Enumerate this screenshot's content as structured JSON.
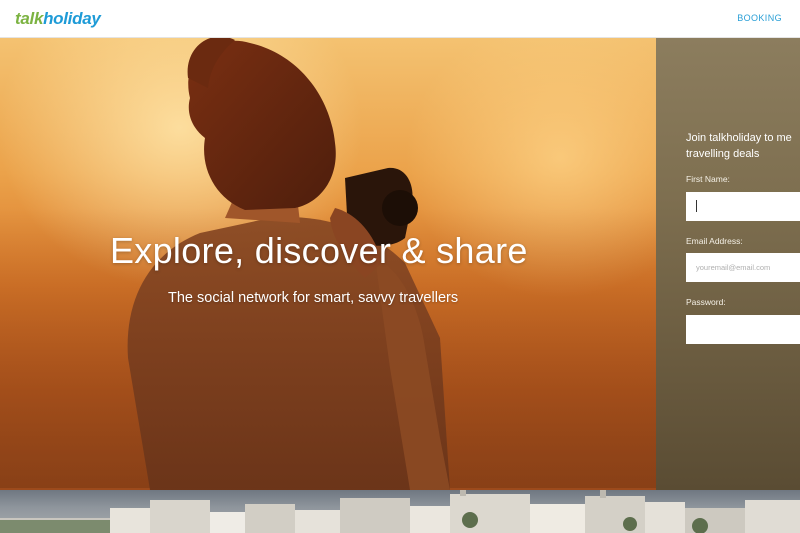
{
  "header": {
    "logo_part1": "talk",
    "logo_part2": "holiday",
    "nav_booking": "BOOKING"
  },
  "hero": {
    "title": "Explore, discover & share",
    "subtitle": "The social network for smart, savvy travellers"
  },
  "signup": {
    "heading_line1": "Join talkholiday to me",
    "heading_line2": "travelling deals",
    "first_name_label": "First Name:",
    "first_name_value": "",
    "email_label": "Email Address:",
    "email_placeholder": "youremail@email.com",
    "password_label": "Password:",
    "password_value": ""
  },
  "colors": {
    "logo_talk": "#7cb342",
    "logo_holiday": "#1e9bd7",
    "nav_link": "#2a9fd6",
    "signup_panel": "#7e6f50"
  },
  "icons": {
    "logo": "talkholiday-logo"
  }
}
